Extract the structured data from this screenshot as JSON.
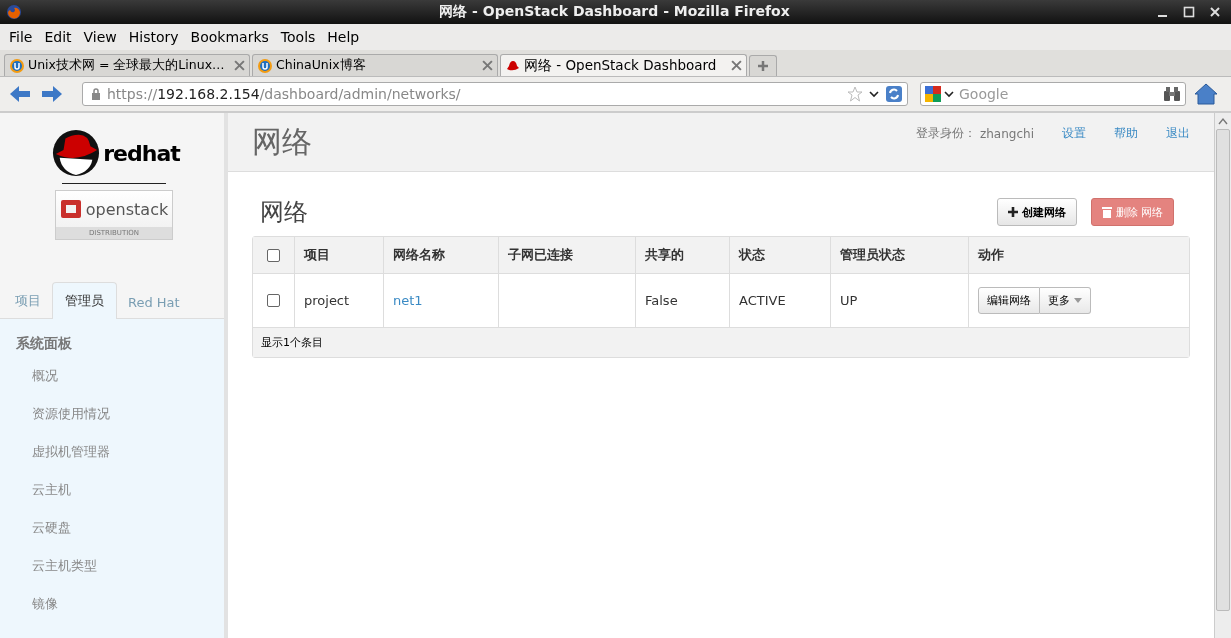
{
  "window": {
    "title": "网络 - OpenStack Dashboard - Mozilla Firefox"
  },
  "menu": [
    {
      "label": "File"
    },
    {
      "label": "Edit"
    },
    {
      "label": "View"
    },
    {
      "label": "History"
    },
    {
      "label": "Bookmarks"
    },
    {
      "label": "Tools"
    },
    {
      "label": "Help"
    }
  ],
  "browser_tabs": [
    {
      "label": "Unix技术网 = 全球最大的Linux…",
      "selected": false,
      "kind": "unix"
    },
    {
      "label": "ChinaUnix博客",
      "selected": false,
      "kind": "unix"
    },
    {
      "label": "网络 - OpenStack Dashboard",
      "selected": true,
      "kind": "redhat"
    }
  ],
  "address_bar": {
    "scheme": "https://",
    "host": "192.168.2.154",
    "path": "/dashboard/admin/networks/"
  },
  "search_field": {
    "placeholder": "Google"
  },
  "logo": {
    "brand": "redhat",
    "product": "openstack",
    "edition": "DISTRIBUTION"
  },
  "sidebar": {
    "tabs": [
      {
        "label": "项目",
        "selected": false
      },
      {
        "label": "管理员",
        "selected": true
      },
      {
        "label": "Red Hat",
        "selected": false
      }
    ],
    "section": "系统面板",
    "items": [
      {
        "label": "概况",
        "selected": false
      },
      {
        "label": "资源使用情况",
        "selected": false
      },
      {
        "label": "虚拟机管理器",
        "selected": false
      },
      {
        "label": "云主机",
        "selected": false
      },
      {
        "label": "云硬盘",
        "selected": false
      },
      {
        "label": "云主机类型",
        "selected": false
      },
      {
        "label": "镜像",
        "selected": false
      }
    ]
  },
  "page_header": {
    "title": "网络",
    "user_label": "登录身份：",
    "user": "zhangchi",
    "links": [
      "设置",
      "帮助",
      "退出"
    ]
  },
  "content": {
    "title": "网络",
    "create_button": "创建网络",
    "delete_button": {
      "label": "删除 网络",
      "disabled": true
    },
    "table": {
      "select_all_checked": false,
      "columns": [
        "项目",
        "网络名称",
        "子网已连接",
        "共享的",
        "状态",
        "管理员状态",
        "动作"
      ],
      "rows": [
        {
          "checked": false,
          "project": "project",
          "name": "net1",
          "shared": "False",
          "status": "ACTIVE",
          "admin_state": "UP",
          "edit_button": "编辑网络",
          "more_button": "更多"
        }
      ],
      "footer": "显示1个条目"
    }
  }
}
